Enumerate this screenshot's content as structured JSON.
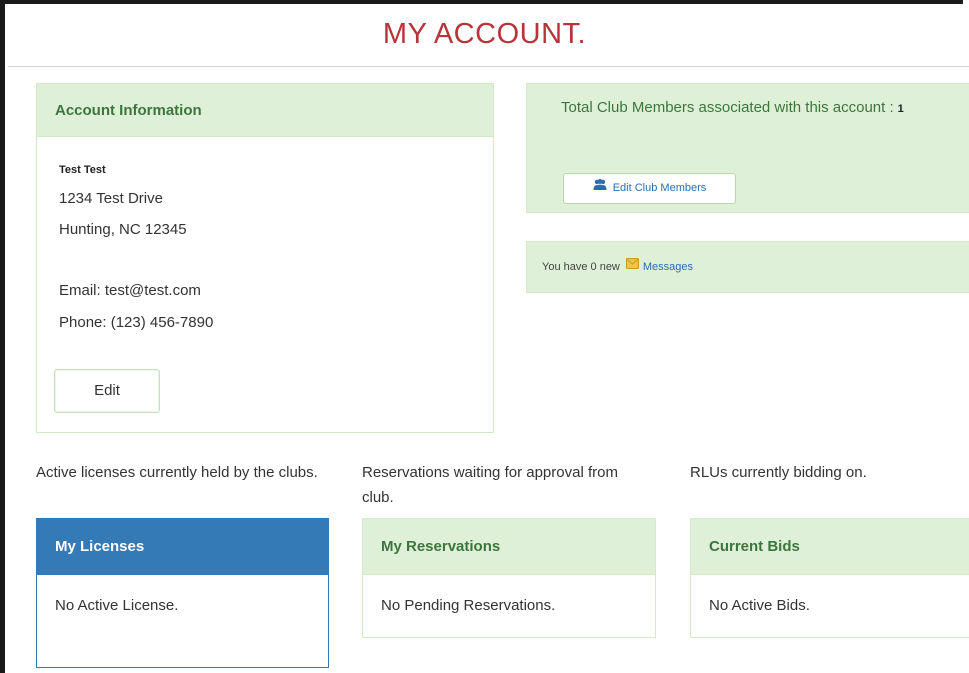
{
  "page": {
    "title": "MY ACCOUNT."
  },
  "account": {
    "header": "Account Information",
    "name": "Test Test",
    "address1": "1234 Test Drive",
    "address2": "Hunting, NC 12345",
    "email": "Email: test@test.com",
    "phone": "Phone: (123) 456-7890",
    "edit_label": "Edit"
  },
  "members": {
    "text": "Total Club Members associated with this account :",
    "count": "1",
    "button_label": "Edit Club Members",
    "icon": "users-icon"
  },
  "messages": {
    "prefix": "You have 0 new",
    "link_label": "Messages",
    "icon": "envelope-icon"
  },
  "sections": {
    "licenses": {
      "caption": "Active licenses currently held by the clubs.",
      "header": "My Licenses",
      "body": "No Active License."
    },
    "reservations": {
      "caption": "Reservations waiting for approval from club.",
      "header": "My Reservations",
      "body": "No Pending Reservations."
    },
    "bids": {
      "caption": "RLUs currently bidding on.",
      "header": "Current Bids",
      "body": "No Active Bids."
    }
  },
  "colors": {
    "title": "#b8333a",
    "panel_green": "#dff0d8",
    "panel_green_text": "#3c763d",
    "primary_blue": "#337ab7",
    "link_blue": "#2a6db0"
  }
}
